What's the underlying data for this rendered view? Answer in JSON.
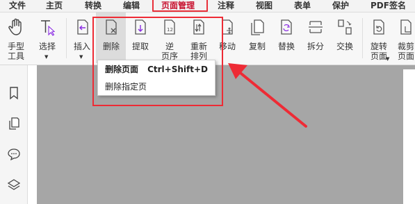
{
  "menubar": {
    "items": [
      {
        "label": "文件"
      },
      {
        "label": "主页"
      },
      {
        "label": "转换"
      },
      {
        "label": "编辑"
      },
      {
        "label": "页面管理"
      },
      {
        "label": "注释"
      },
      {
        "label": "视图"
      },
      {
        "label": "表单"
      },
      {
        "label": "保护"
      },
      {
        "label": "PDF签名"
      }
    ],
    "active": "页面管理"
  },
  "ribbon": {
    "buttons": [
      {
        "label": "手型\n工具",
        "icon": "hand-icon"
      },
      {
        "label": "选择",
        "icon": "text-select-icon"
      },
      {
        "label": "插入",
        "icon": "insert-page-icon"
      },
      {
        "label": "删除",
        "icon": "delete-page-icon"
      },
      {
        "label": "提取",
        "icon": "extract-page-icon"
      },
      {
        "label": "逆\n页序",
        "icon": "reverse-page-icon"
      },
      {
        "label": "重新\n排列",
        "icon": "reorder-page-icon"
      },
      {
        "label": "移动",
        "icon": "move-page-icon"
      },
      {
        "label": "复制",
        "icon": "copy-page-icon"
      },
      {
        "label": "替换",
        "icon": "replace-page-icon"
      },
      {
        "label": "拆分",
        "icon": "split-page-icon"
      },
      {
        "label": "交换",
        "icon": "swap-page-icon"
      },
      {
        "label": "旋转\n页面",
        "icon": "rotate-page-icon"
      },
      {
        "label": "裁剪\n页面",
        "icon": "crop-page-icon"
      }
    ]
  },
  "dropdown": {
    "items": [
      {
        "label": "删除页面",
        "shortcut": "Ctrl+Shift+D"
      },
      {
        "label": "删除指定页"
      }
    ]
  },
  "leftpanel": {
    "icons": [
      "bookmark-icon",
      "pages-icon",
      "comment-icon",
      "layers-icon"
    ]
  },
  "colors": {
    "accent": "#c8102e",
    "annotation": "#ee2b35",
    "canvas": "#a6a6a6"
  }
}
